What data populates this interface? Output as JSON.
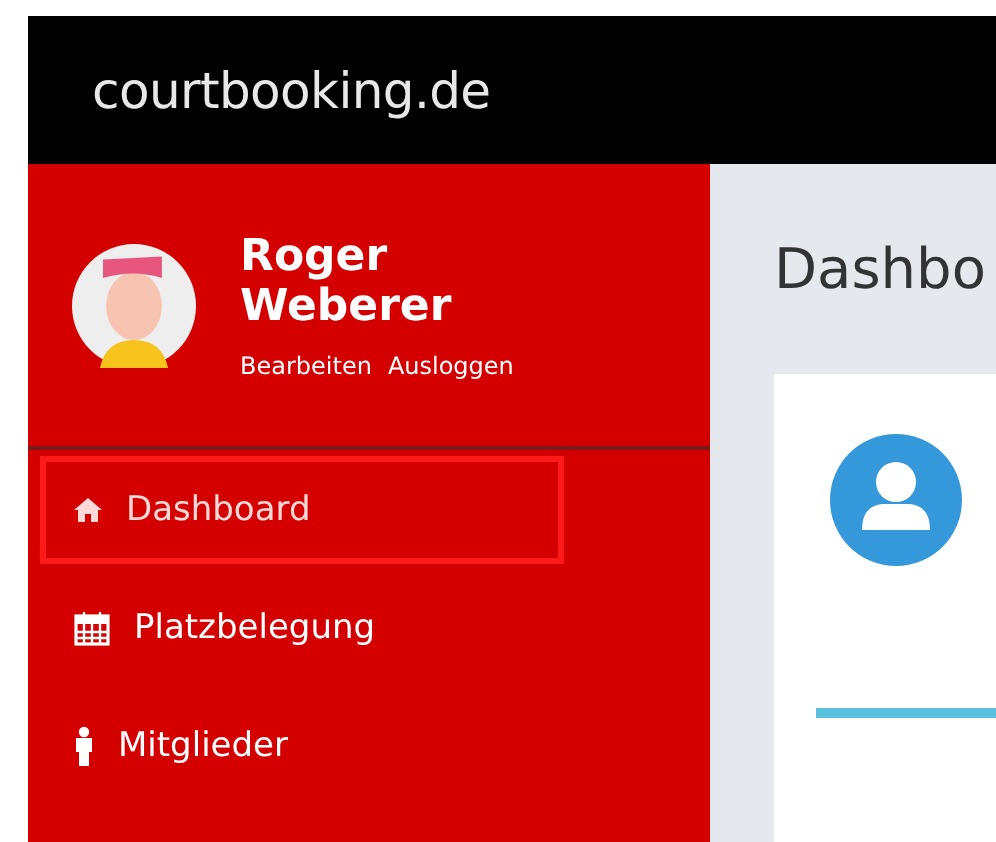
{
  "header": {
    "logo": "courtbooking.de"
  },
  "profile": {
    "name": "Roger Weberer",
    "links": [
      "Bearbeiten",
      "Ausloggen"
    ]
  },
  "sidebar": {
    "items": [
      {
        "label": "Dashboard",
        "selected": true
      },
      {
        "label": "Platzbelegung",
        "selected": false
      },
      {
        "label": "Mitglieder",
        "selected": false
      }
    ]
  },
  "main": {
    "title": "Dashbo"
  }
}
